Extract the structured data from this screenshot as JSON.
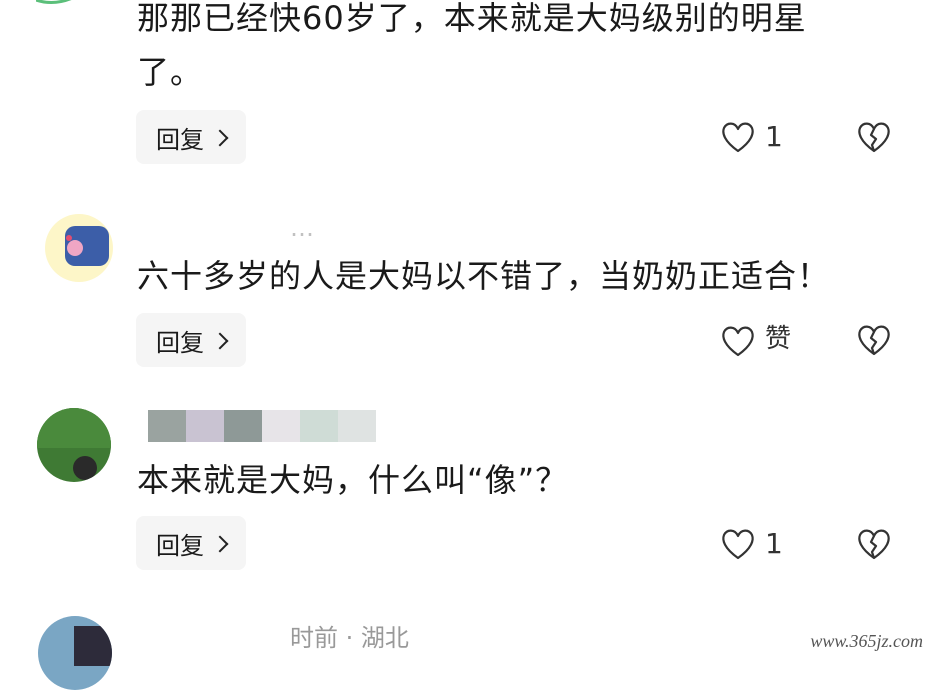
{
  "comments": [
    {
      "text_line1": "那那已经快60岁了，本来就是大妈级别的明星",
      "text_line2": "了。",
      "reply_label": "回复",
      "like_count": "1"
    },
    {
      "meta": "…",
      "text": "六十多岁的人是大妈以不错了，当奶奶正适合！",
      "reply_label": "回复",
      "like_count": "赞"
    },
    {
      "text": "本来就是大妈，什么叫“像”？",
      "reply_label": "回复",
      "like_count": "1"
    },
    {
      "meta": "时前 · 湖北"
    }
  ],
  "watermark": "www.365jz.com",
  "icons": {
    "chevron": "chevron-right-icon",
    "like": "heart-outline-icon",
    "dislike": "broken-heart-icon"
  }
}
